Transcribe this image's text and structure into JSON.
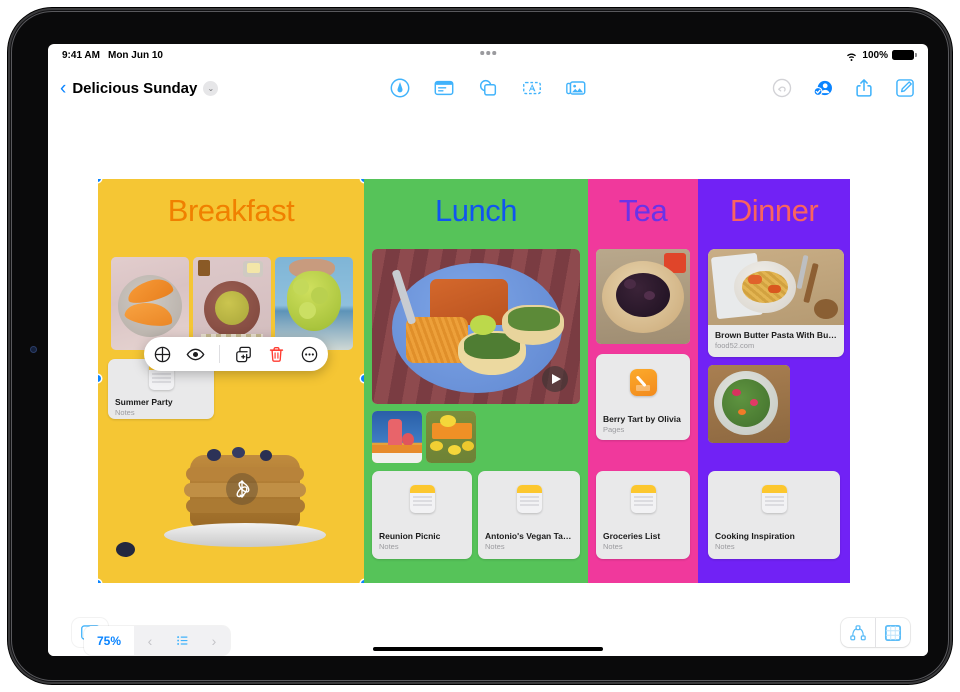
{
  "status_bar": {
    "time": "9:41 AM",
    "date": "Mon Jun 10",
    "battery_percent": "100%",
    "wifi_icon": "wifi-icon",
    "battery_icon": "battery-full-icon"
  },
  "toolbar": {
    "back_chevron": "‹",
    "doc_title": "Delicious Sunday",
    "title_caret": "⌄",
    "center_tools": [
      {
        "name": "markup-pen-icon",
        "label": "Markup"
      },
      {
        "name": "sticky-note-icon",
        "label": "Sticky Note"
      },
      {
        "name": "shapes-icon",
        "label": "Shapes"
      },
      {
        "name": "text-box-icon",
        "label": "Text Box"
      },
      {
        "name": "media-icon",
        "label": "Media"
      }
    ],
    "right_tools": [
      {
        "name": "undo-icon",
        "label": "Undo",
        "enabled": false
      },
      {
        "name": "collaborate-icon",
        "label": "Collaborate",
        "enabled": true
      },
      {
        "name": "share-icon",
        "label": "Share",
        "enabled": true
      },
      {
        "name": "compose-icon",
        "label": "New",
        "enabled": true
      }
    ]
  },
  "boards": [
    {
      "name": "breakfast",
      "title": "Breakfast",
      "bg_color": "#f5c634",
      "title_color": "#f08000",
      "selected": true
    },
    {
      "name": "lunch",
      "title": "Lunch",
      "bg_color": "#56c359",
      "title_color": "#1055ef",
      "selected": false
    },
    {
      "name": "tea",
      "title": "Tea",
      "bg_color": "#f0399c",
      "title_color": "#6a33e8",
      "selected": false
    },
    {
      "name": "dinner",
      "title": "Dinner",
      "bg_color": "#7122f5",
      "title_color": "#f9645f",
      "selected": false
    }
  ],
  "cards": {
    "summer_party": {
      "title": "Summer Party",
      "subtitle": "Notes",
      "app": "notes"
    },
    "reunion_picnic": {
      "title": "Reunion Picnic",
      "subtitle": "Notes",
      "app": "notes"
    },
    "antonios_vegan_tacos": {
      "title": "Antonio's Vegan Tacos",
      "subtitle": "Notes",
      "app": "notes"
    },
    "berry_tart": {
      "title": "Berry Tart by Olivia",
      "subtitle": "Pages",
      "app": "pages"
    },
    "groceries_list": {
      "title": "Groceries List",
      "subtitle": "Notes",
      "app": "notes"
    },
    "cooking_inspiration": {
      "title": "Cooking Inspiration",
      "subtitle": "Notes",
      "app": "notes"
    },
    "pasta_link": {
      "title": "Brown Butter Pasta With But...",
      "subtitle": "food52.com",
      "app": "link"
    }
  },
  "context_menu": {
    "items": [
      {
        "name": "share-link-icon",
        "label": "Share Link"
      },
      {
        "name": "eye-preview-icon",
        "label": "Preview"
      },
      {
        "name": "duplicate-icon",
        "label": "Duplicate"
      },
      {
        "name": "delete-trash-icon",
        "label": "Delete"
      },
      {
        "name": "more-ellipsis-icon",
        "label": "More"
      }
    ],
    "delete_color": "#ff3b30"
  },
  "bottom_bar": {
    "zoom_level": "75%",
    "prev_label": "‹",
    "next_label": "›",
    "list_icon": "list-icon",
    "star_icon": "star-box-icon",
    "diagram_icon": "diagram-icon",
    "grid_icon": "grid-icon"
  },
  "media": {
    "play_icon": "play-button-icon",
    "ar_icon": "rotate-3d-icon"
  },
  "accent_color": "#0a84ff"
}
